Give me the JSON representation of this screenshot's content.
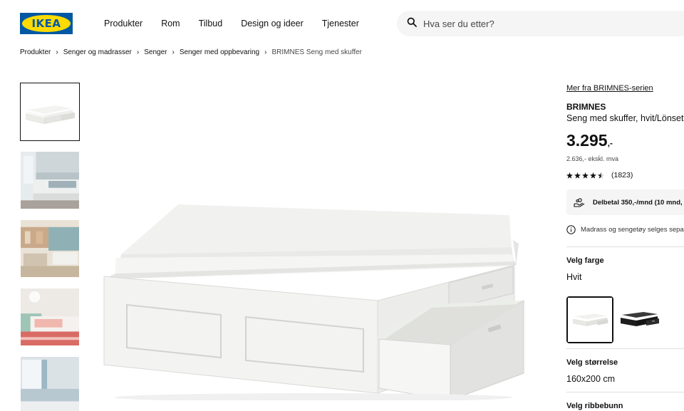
{
  "header": {
    "logo_text": "IKEA",
    "nav": [
      "Produkter",
      "Rom",
      "Tilbud",
      "Design og ideer",
      "Tjenester"
    ],
    "search_placeholder": "Hva ser du etter?"
  },
  "breadcrumb": {
    "items": [
      "Produkter",
      "Senger og madrasser",
      "Senger",
      "Senger med oppbevaring"
    ],
    "current": "BRIMNES Seng med skuffer"
  },
  "gallery": {
    "thumbnails": [
      "bed-white-studio",
      "bedroom-scene-1",
      "bedroom-scene-2",
      "bedroom-scene-3",
      "bedroom-scene-4"
    ],
    "selected_index": 0
  },
  "product": {
    "series_link": "Mer fra BRIMNES-serien",
    "name": "BRIMNES",
    "description": "Seng med skuffer, hvit/Lönset",
    "price": "3.295",
    "price_suffix": ",-",
    "price_ex_vat": "2.636,- eksḱl. mva",
    "rating_value": 4.5,
    "rating_count": "(1823)",
    "installment": "Delbetal 350,-/mnd (10 mnd,",
    "notice": "Madrass og sengetøy selges separ",
    "color_label": "Velg farge",
    "color_value": "Hvit",
    "color_options": [
      "white",
      "black"
    ],
    "size_label": "Velg størrelse",
    "size_value": "160x200 cm",
    "slats_label": "Velg ribbebunn"
  },
  "colors": {
    "brand_blue": "#0058a3",
    "brand_yellow": "#ffdb00"
  }
}
